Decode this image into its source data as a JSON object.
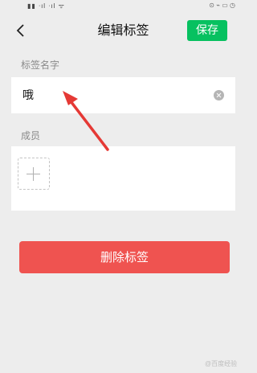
{
  "status_bar": {
    "left": "▮▮ ᐧıl ᐧıl ᯤ",
    "right": "⊙ ⌁ ▭ ◷"
  },
  "nav": {
    "title": "编辑标签",
    "save_label": "保存"
  },
  "tag_name": {
    "section_label": "标签名字",
    "value": "哦"
  },
  "members": {
    "section_label": "成员"
  },
  "delete_label": "删除标签",
  "watermark": "@百度经验",
  "annotation_color": "#e53935",
  "accent_color": "#07c160",
  "danger_color": "#ef5350",
  "icons": [
    "back-arrow-icon",
    "clear-icon",
    "add-member-icon"
  ]
}
